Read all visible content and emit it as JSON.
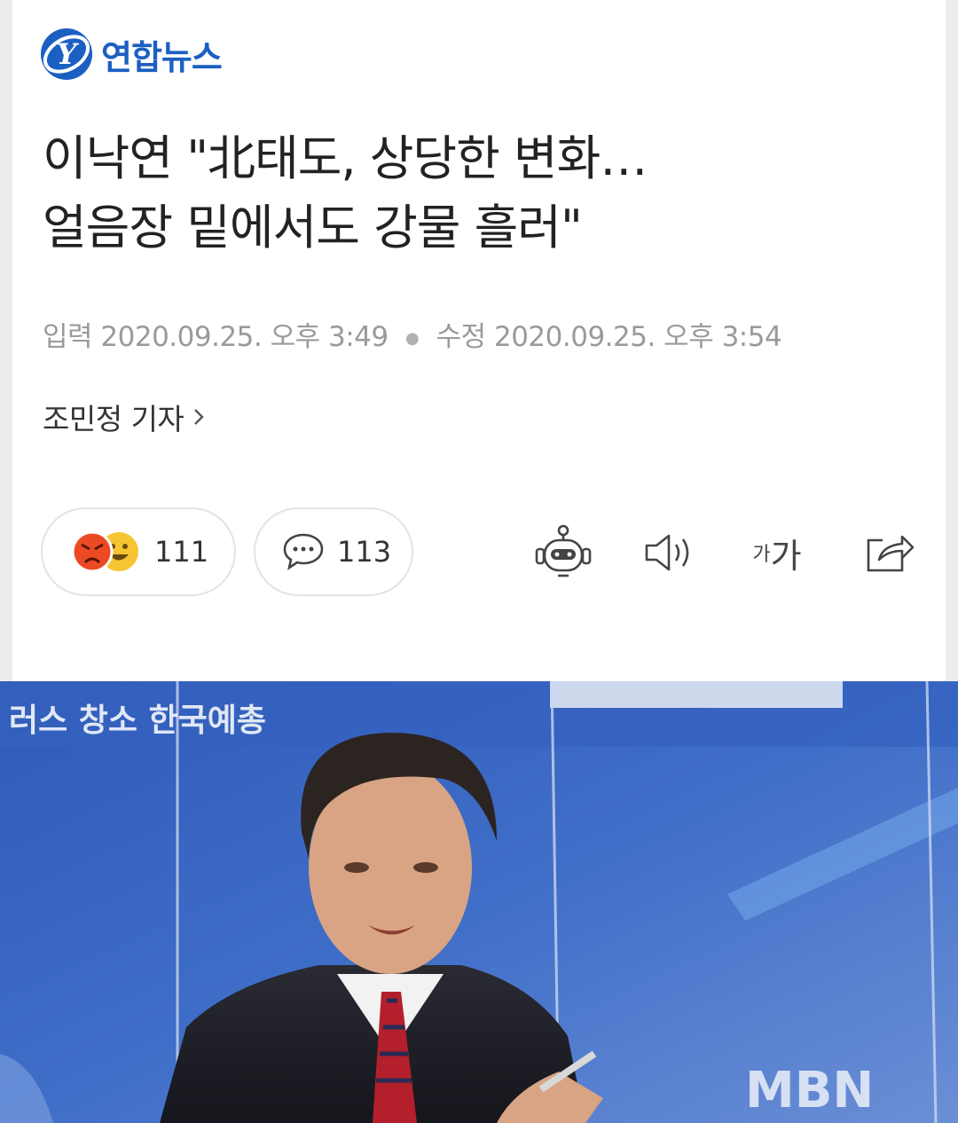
{
  "brand": {
    "name": "연합뉴스",
    "logo_letter": "Y",
    "color": "#1c5fc2"
  },
  "article": {
    "title_line1": "이낙연 \"北태도, 상당한 변화…",
    "title_line2": "얼음장 밑에서도 강물 흘러\"",
    "input_label": "입력",
    "input_time": "2020.09.25. 오후 3:49",
    "edit_label": "수정",
    "edit_time": "2020.09.25. 오후 3:54",
    "reporter": "조민정 기자"
  },
  "actions": {
    "reaction_count": "111",
    "comment_count": "113",
    "font_small": "가",
    "font_large": "가"
  },
  "icons": {
    "robot": "robot-summary-icon",
    "sound": "speaker-icon",
    "share": "share-icon",
    "comment": "speech-bubble-icon",
    "reporter_chevron": "chevron-right-icon"
  },
  "photo": {
    "backdrop_text": "러스  창소  한국예총",
    "backdrop_logo": "MBN"
  }
}
